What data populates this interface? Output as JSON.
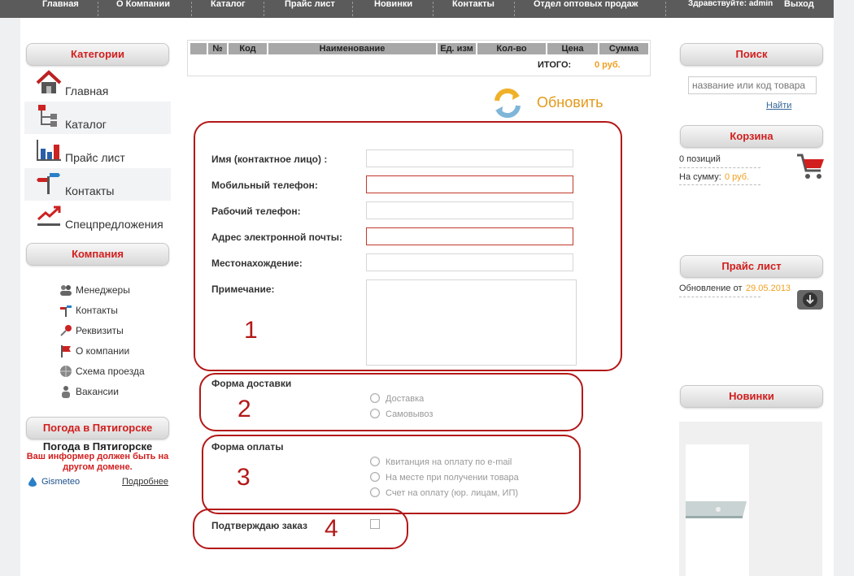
{
  "nav": {
    "items": [
      "Главная",
      "О Компании",
      "Каталог",
      "Прайс лист",
      "Новинки",
      "Контакты",
      "Отдел оптовых продаж"
    ],
    "greeting": "Здравствуйте: admin",
    "logout": "Выход"
  },
  "sidebar": {
    "categories_title": "Категории",
    "categories": [
      {
        "label": "Главная",
        "icon": "home-icon"
      },
      {
        "label": "Каталог",
        "icon": "catalog-tree-icon"
      },
      {
        "label": "Прайс лист",
        "icon": "bar-chart-icon"
      },
      {
        "label": "Контакты",
        "icon": "signpost-icon"
      },
      {
        "label": "Спецпредложения",
        "icon": "trend-up-icon"
      }
    ],
    "company_title": "Компания",
    "company": [
      {
        "label": "Менеджеры",
        "icon": "users-icon"
      },
      {
        "label": "Контакты",
        "icon": "signpost-icon"
      },
      {
        "label": "Реквизиты",
        "icon": "key-icon"
      },
      {
        "label": "О компании",
        "icon": "flag-icon"
      },
      {
        "label": "Схема проезда",
        "icon": "globe-icon"
      },
      {
        "label": "Вакансии",
        "icon": "person-icon"
      }
    ],
    "weather_title": "Погода в Пятигорске",
    "weather_heading": "Погода в Пятигорске",
    "weather_msg": "Ваш информер должен быть на другом домене.",
    "gismeteo": "Gismeteo",
    "more": "Подробнее"
  },
  "table": {
    "headers": [
      "№",
      "Код",
      "Наименование",
      "Ед. изм",
      "Кол-во",
      "Цена",
      "Сумма"
    ],
    "total_label": "ИТОГО:",
    "total_value": "0 руб."
  },
  "refresh_label": "Обновить",
  "form": {
    "fields": [
      "Имя (контактное лицо) :",
      "Мобильный телефон:",
      "Рабочий телефон:",
      "Адрес электронной почты:",
      "Местонахождение:"
    ],
    "note_label": "Примечание:",
    "delivery_title": "Форма доставки",
    "delivery_options": [
      "Доставка",
      "Самовывоз"
    ],
    "payment_title": "Форма оплаты",
    "payment_options": [
      "Квитанция на оплату по e-mail",
      "На месте при получении товара",
      "Счет на оплату (юр. лицам, ИП)"
    ],
    "confirm_label": "Подтверждаю заказ"
  },
  "annotations": [
    "1",
    "2",
    "3",
    "4"
  ],
  "right": {
    "search_title": "Поиск",
    "search_placeholder": "название или код товара",
    "search_button": "Найти",
    "cart_title": "Корзина",
    "cart_positions": "0 позиций",
    "cart_sum_label": "На сумму:",
    "cart_sum_value": "0 руб.",
    "price_title": "Прайс лист",
    "price_update_label": "Обновление от",
    "price_update_date": "29.05.2013",
    "news_title": "Новинки"
  }
}
